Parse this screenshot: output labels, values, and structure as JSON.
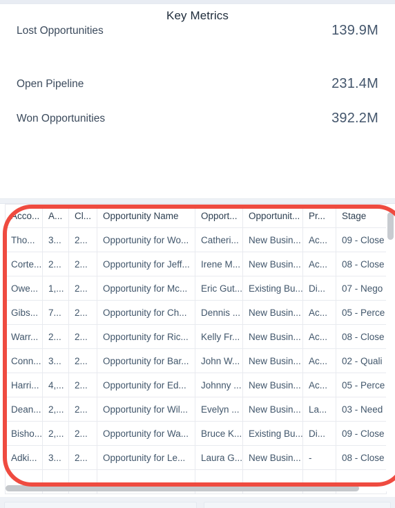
{
  "metrics_card": {
    "title": "Key Metrics",
    "rows": [
      {
        "label": "Open Pipeline",
        "value": "231.4M"
      },
      {
        "label": "Won Opportunities",
        "value": "392.2M"
      },
      {
        "label": "Lost Opportunities",
        "value": "139.9M"
      }
    ]
  },
  "table": {
    "columns": [
      "Acco...",
      "A...",
      "Cl...",
      "Opportunity Name",
      "Opport...",
      "Opportunit...",
      "Pr...",
      "Stage"
    ],
    "rows": [
      [
        "Tho...",
        "3...",
        "2...",
        "Opportunity for Wo...",
        "Catheri...",
        "New Busin...",
        "Ac...",
        "09 - Close"
      ],
      [
        "Corte...",
        "2...",
        "2...",
        "Opportunity for Jeff...",
        "Irene M...",
        "New Busin...",
        "Ac...",
        "08 - Close"
      ],
      [
        "Owe...",
        "1,...",
        "2...",
        "Opportunity for Mc...",
        "Eric Gut...",
        "Existing Bu...",
        "Di...",
        "07 - Nego"
      ],
      [
        "Gibs...",
        "7...",
        "2...",
        "Opportunity for Ch...",
        "Dennis ...",
        "New Busin...",
        "Ac...",
        "05 - Perce"
      ],
      [
        "Warr...",
        "2...",
        "2...",
        "Opportunity for Ric...",
        "Kelly Fr...",
        "New Busin...",
        "Ac...",
        "08 - Close"
      ],
      [
        "Conn...",
        "3...",
        "2...",
        "Opportunity for Bar...",
        "John W...",
        "New Busin...",
        "Ac...",
        "02 - Quali"
      ],
      [
        "Harri...",
        "4,...",
        "2...",
        "Opportunity for Ed...",
        "Johnny ...",
        "New Busin...",
        "Ac...",
        "05 - Perce"
      ],
      [
        "Dean...",
        "2,...",
        "2...",
        "Opportunity for Wil...",
        "Evelyn ...",
        "New Busin...",
        "La...",
        "03 - Need"
      ],
      [
        "Bisho...",
        "2,...",
        "2...",
        "Opportunity for Wa...",
        "Bruce K...",
        "Existing Bu...",
        "Di...",
        "09 - Close"
      ],
      [
        "Adki...",
        "3...",
        "2...",
        "Opportunity for Le...",
        "Laura G...",
        "New Busin...",
        "-",
        "08 - Close"
      ],
      [
        "",
        "",
        "",
        "",
        "",
        "",
        "",
        ""
      ]
    ]
  },
  "annotation": {
    "shape": "oval-highlight",
    "color": "#ef4b40"
  },
  "scrollbars": {
    "vertical": "vertical-scrollbar",
    "horizontal": "horizontal-scrollbar"
  }
}
